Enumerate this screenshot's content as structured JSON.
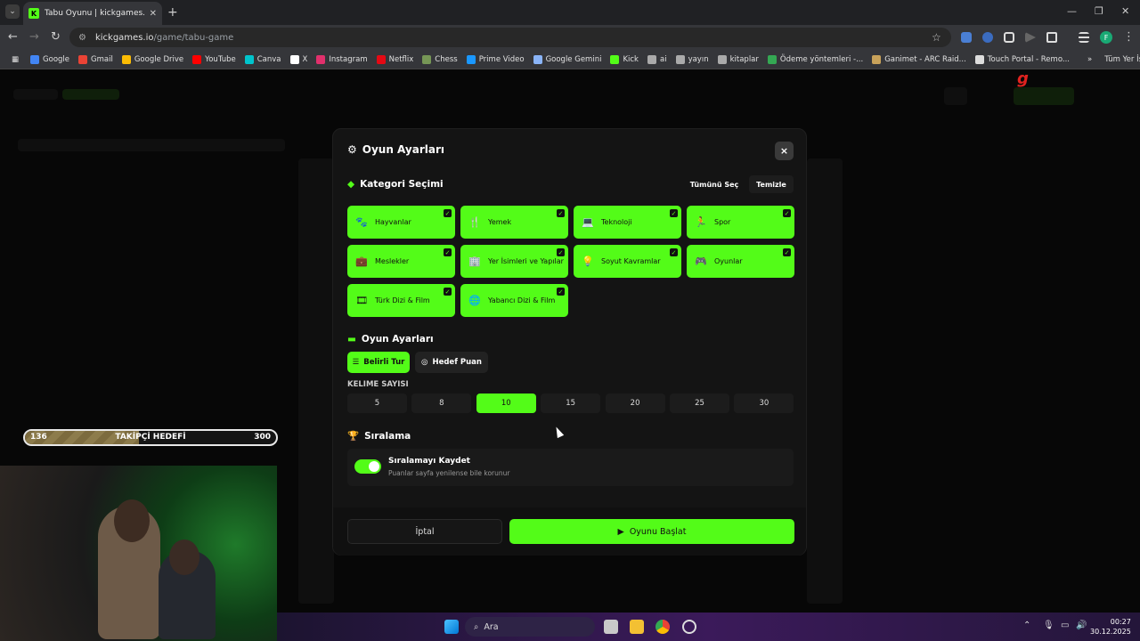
{
  "browser": {
    "tab_title": "Tabu Oyunu | kickgames.io",
    "url_host": "kickgames.io",
    "url_path": "/game/tabu-game",
    "bookmarks": [
      {
        "label": "Google",
        "color": "#4285f4"
      },
      {
        "label": "Gmail",
        "color": "#ea4335"
      },
      {
        "label": "Google Drive",
        "color": "#fbbc04"
      },
      {
        "label": "YouTube",
        "color": "#ff0000"
      },
      {
        "label": "Canva",
        "color": "#00c4cc"
      },
      {
        "label": "X",
        "color": "#ffffff"
      },
      {
        "label": "Instagram",
        "color": "#e1306c"
      },
      {
        "label": "Netflix",
        "color": "#e50914"
      },
      {
        "label": "Chess",
        "color": "#769656"
      },
      {
        "label": "Prime Video",
        "color": "#1a98ff"
      },
      {
        "label": "Google Gemini",
        "color": "#8ab4f8"
      },
      {
        "label": "Kick",
        "color": "#53fc18"
      },
      {
        "label": "ai",
        "color": "#aaaaaa"
      },
      {
        "label": "yayın",
        "color": "#aaaaaa"
      },
      {
        "label": "kitaplar",
        "color": "#aaaaaa"
      },
      {
        "label": "Ödeme yöntemleri -...",
        "color": "#34a853"
      },
      {
        "label": "Ganimet - ARC Raid...",
        "color": "#c8a25a"
      },
      {
        "label": "Touch Portal - Remo...",
        "color": "#dddddd"
      }
    ],
    "all_bookmarks": "Tüm Yer İşaretleri",
    "profile_initial": "F"
  },
  "modal": {
    "title": "Oyun Ayarları",
    "close": "×",
    "category_section": "Kategori Seçimi",
    "select_all": "Tümünü Seç",
    "clear": "Temizle",
    "categories": [
      {
        "label": "Hayvanlar",
        "icon": "paw-icon",
        "glyph": "🐾"
      },
      {
        "label": "Yemek",
        "icon": "utensils-icon",
        "glyph": "🍴"
      },
      {
        "label": "Teknoloji",
        "icon": "laptop-icon",
        "glyph": "💻"
      },
      {
        "label": "Spor",
        "icon": "running-icon",
        "glyph": "🏃"
      },
      {
        "label": "Meslekler",
        "icon": "briefcase-icon",
        "glyph": "💼"
      },
      {
        "label": "Yer İsimleri ve Yapılar",
        "icon": "building-icon",
        "glyph": "🏢"
      },
      {
        "label": "Soyut Kavramlar",
        "icon": "lightbulb-icon",
        "glyph": "💡"
      },
      {
        "label": "Oyunlar",
        "icon": "gamepad-icon",
        "glyph": "🎮"
      },
      {
        "label": "Türk Dizi & Film",
        "icon": "film-icon",
        "glyph": "🎞"
      },
      {
        "label": "Yabancı Dizi & Film",
        "icon": "globe-icon",
        "glyph": "🌐"
      }
    ],
    "game_settings_section": "Oyun Ayarları",
    "mode_rounds": "Belirli Tur",
    "mode_target": "Hedef Puan",
    "word_count_label": "KELIME SAYISI",
    "word_counts": [
      "5",
      "8",
      "10",
      "15",
      "20",
      "25",
      "30"
    ],
    "selected_word_count": "10",
    "ranking_section": "Sıralama",
    "ranking_title": "Sıralamayı Kaydet",
    "ranking_sub": "Puanlar sayfa yenilense bile korunur",
    "cancel": "İptal",
    "start": "Oyunu Başlat",
    "accent": "#53fc18"
  },
  "follower_goal": {
    "current": "136",
    "title": "TAKİPÇİ HEDEFİ",
    "target": "300",
    "progress_fraction": 0.453
  },
  "taskbar": {
    "search": "Ara",
    "time": "00:27",
    "date": "30.12.2025"
  }
}
